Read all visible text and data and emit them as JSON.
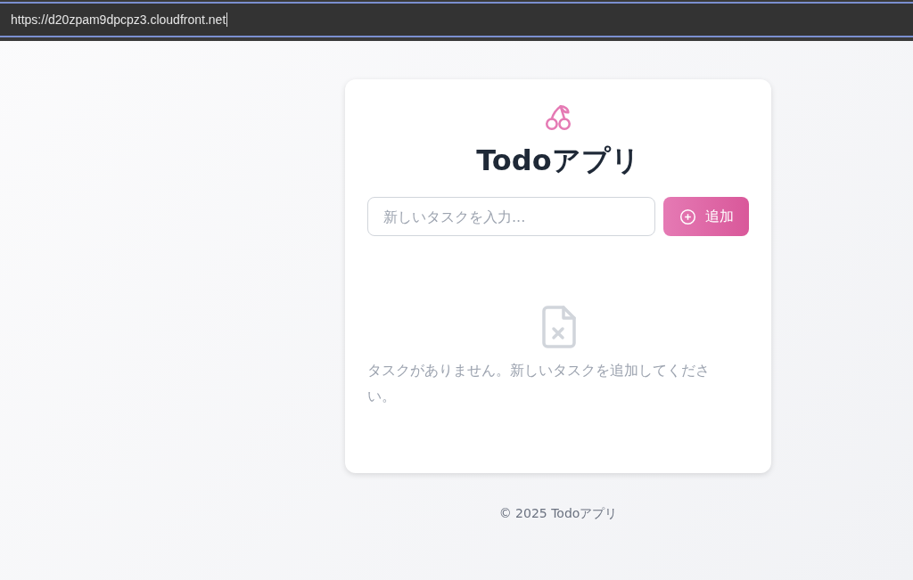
{
  "address_bar": {
    "url": "https://d20zpam9dpcpz3.cloudfront.net"
  },
  "app": {
    "title": "Todoアプリ",
    "task_input": {
      "placeholder": "新しいタスクを入力..."
    },
    "add_button": "追加",
    "empty_message": "タスクがありません。新しいタスクを追加してください。"
  },
  "footer": "© 2025 Todoアプリ"
}
